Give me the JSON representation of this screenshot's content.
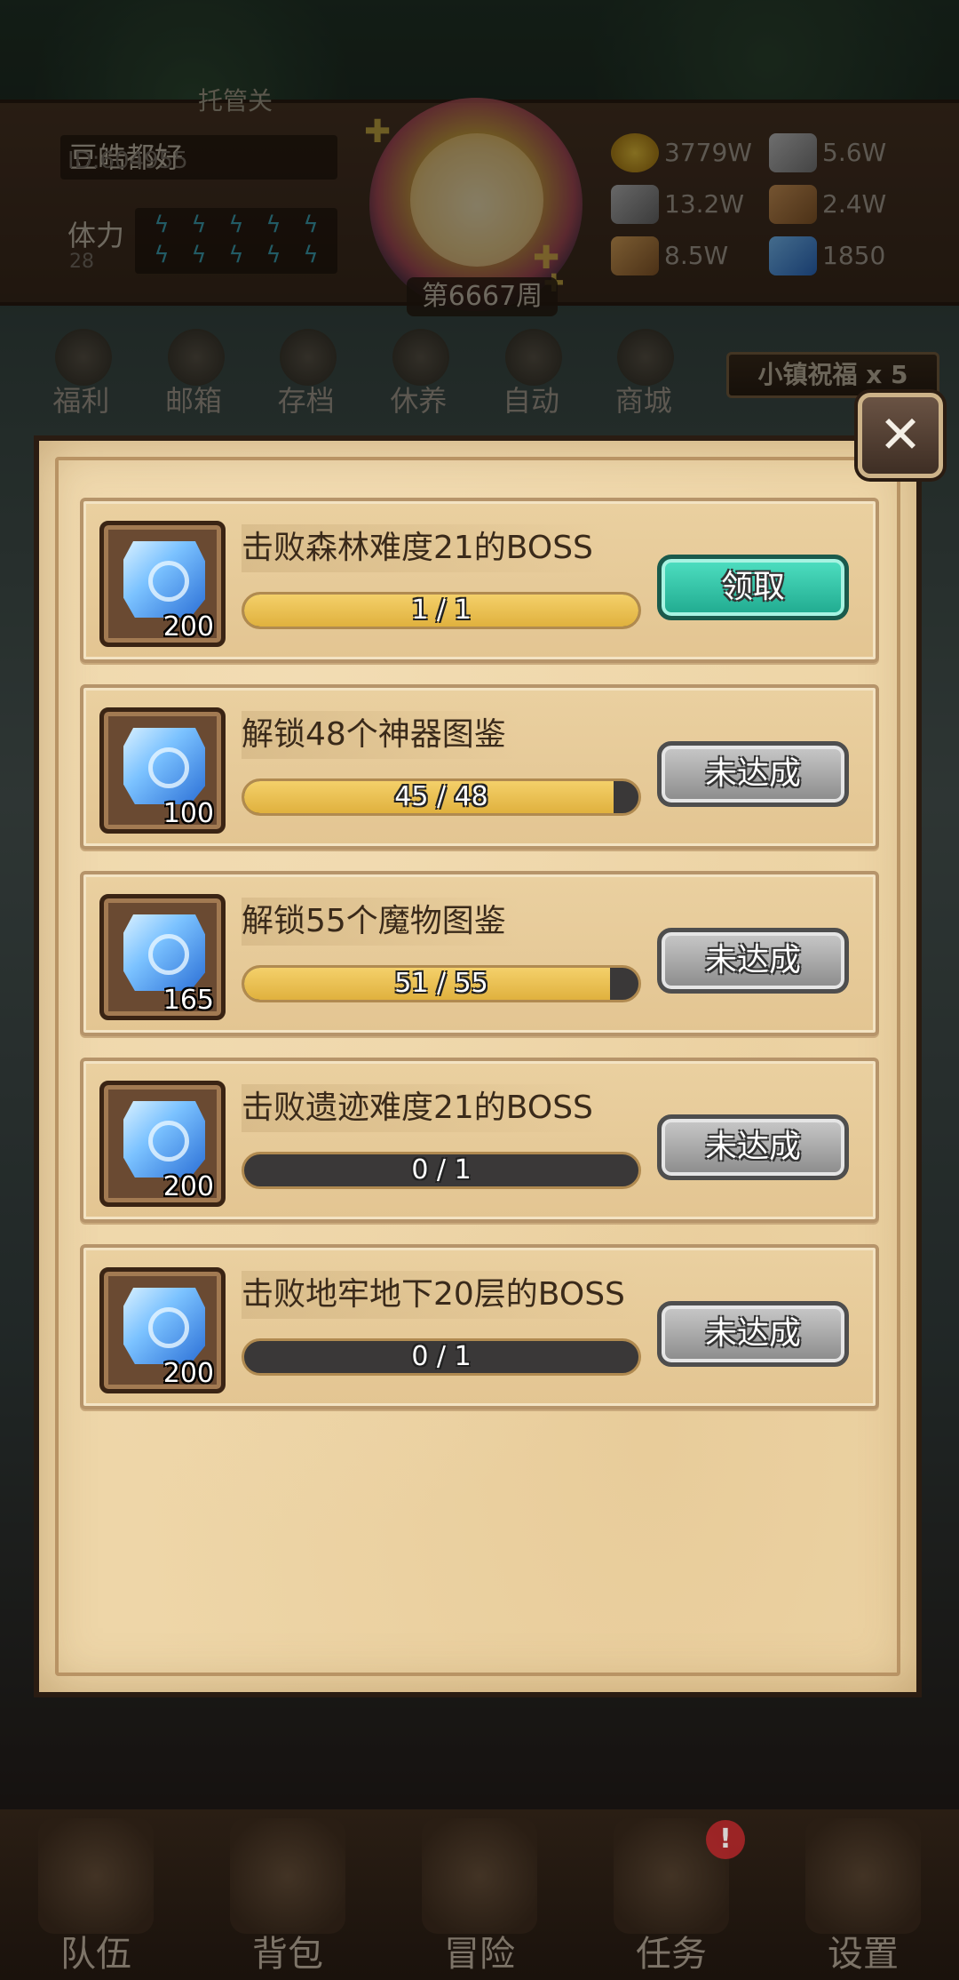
{
  "header": {
    "proxy_label": "托管关",
    "player_name": "豆皓都好",
    "player_id": "ID:604955",
    "stamina_label": "体力",
    "stamina_value": "28",
    "week_label": "第6667周",
    "resources": [
      {
        "icon": "gold-coin-icon",
        "value": "3779W"
      },
      {
        "icon": "iron-ingot-icon",
        "value": "5.6W"
      },
      {
        "icon": "stone-icon",
        "value": "13.2W"
      },
      {
        "icon": "leather-icon",
        "value": "2.4W"
      },
      {
        "icon": "wood-icon",
        "value": "8.5W"
      },
      {
        "icon": "crystal-icon",
        "value": "1850"
      }
    ]
  },
  "nav": {
    "items": [
      {
        "label": "福利",
        "icon": "welfare-icon"
      },
      {
        "label": "邮箱",
        "icon": "mailbox-icon"
      },
      {
        "label": "存档",
        "icon": "save-icon"
      },
      {
        "label": "休养",
        "icon": "rest-icon"
      },
      {
        "label": "自动",
        "icon": "auto-icon"
      },
      {
        "label": "商城",
        "icon": "shop-icon"
      }
    ],
    "town_blessing": "小镇祝福 x 5"
  },
  "tasks": [
    {
      "title": "击败森林难度21的BOSS",
      "reward": "200",
      "progress_text": "1 / 1",
      "progress": 1.0,
      "button": "领取",
      "status": "claimable"
    },
    {
      "title": "解锁48个神器图鉴",
      "reward": "100",
      "progress_text": "45 / 48",
      "progress": 0.9375,
      "button": "未达成",
      "status": "locked"
    },
    {
      "title": "解锁55个魔物图鉴",
      "reward": "165",
      "progress_text": "51 / 55",
      "progress": 0.9273,
      "button": "未达成",
      "status": "locked"
    },
    {
      "title": "击败遗迹难度21的BOSS",
      "reward": "200",
      "progress_text": "0 / 1",
      "progress": 0.0,
      "button": "未达成",
      "status": "locked"
    },
    {
      "title": "击败地牢地下20层的BOSS",
      "reward": "200",
      "progress_text": "0 / 1",
      "progress": 0.0,
      "button": "未达成",
      "status": "locked"
    }
  ],
  "bottom_nav": [
    {
      "label": "队伍",
      "icon": "helmet-icon"
    },
    {
      "label": "背包",
      "icon": "backpack-icon"
    },
    {
      "label": "冒险",
      "icon": "crossed-swords-icon"
    },
    {
      "label": "任务",
      "icon": "quest-scroll-icon",
      "alert": "!"
    },
    {
      "label": "设置",
      "icon": "gear-icon"
    }
  ],
  "colors": {
    "claim_button": "#1fa98e",
    "locked_button": "#8a8a8a",
    "progress_fill": "#e0b13e",
    "panel_bg": "#eed6a8"
  }
}
